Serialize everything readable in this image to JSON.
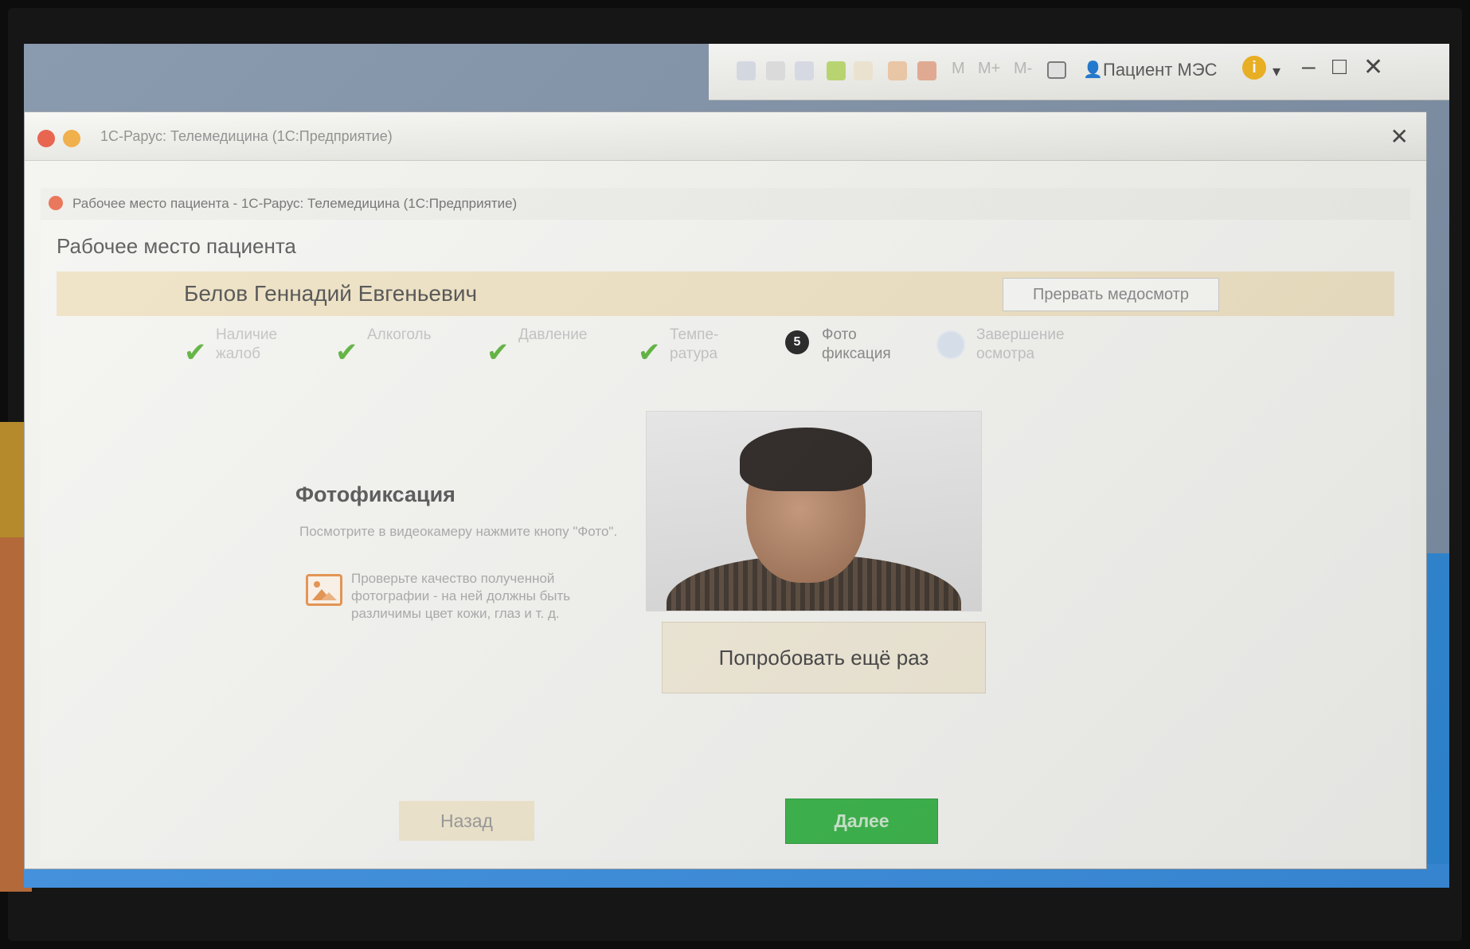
{
  "outer_window": {
    "title": "1С-Рарус: Телемедицина (1С:Предприятие)"
  },
  "system_toolbar": {
    "memory_buttons": [
      "M",
      "M+",
      "M-"
    ],
    "user_name": "Пациент МЭС"
  },
  "inner_window": {
    "tab_title": "Рабочее место пациента - 1С-Рарус: Телемедицина (1С:Предприятие)"
  },
  "form": {
    "title": "Рабочее место пациента",
    "patient_name": "Белов Геннадий Евгеньевич",
    "interrupt_button": "Прервать медосмотр"
  },
  "steps": [
    {
      "label": "Наличие\nжалоб",
      "state": "done"
    },
    {
      "label": "Алкоголь",
      "state": "done"
    },
    {
      "label": "Давление",
      "state": "done"
    },
    {
      "label": "Темпе-\nратура",
      "state": "done"
    },
    {
      "number": "5",
      "label": "Фото\nфиксация",
      "state": "active"
    },
    {
      "label": "Завершение\nосмотра",
      "state": "future"
    }
  ],
  "photo_section": {
    "title": "Фотофиксация",
    "description": "Посмотрите в видеокамеру нажмите кнопу \"Фото\".",
    "quality_hint": "Проверьте качество полученной фотографии - на ней должны быть различимы цвет кожи, глаз и т. д.",
    "retry_button": "Попробовать ещё раз"
  },
  "navigation": {
    "back_button": "Назад",
    "next_button": "Далее"
  }
}
